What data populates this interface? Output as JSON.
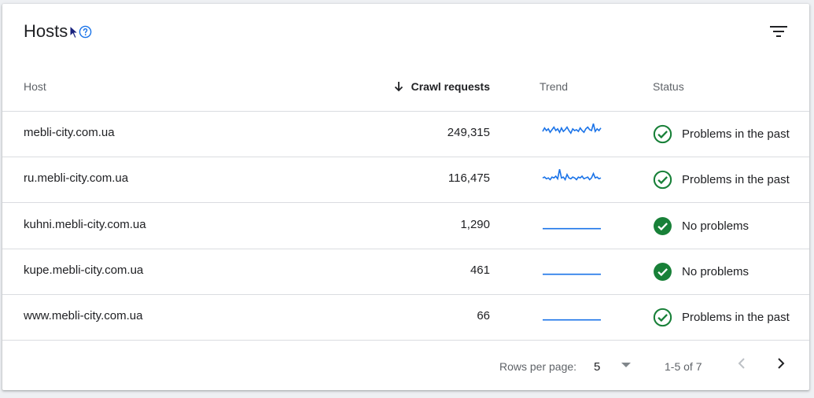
{
  "header": {
    "title": "Hosts",
    "help_icon": "help-circle-icon",
    "filter_icon": "filter-icon"
  },
  "table": {
    "columns": {
      "host": "Host",
      "crawl_requests": "Crawl requests",
      "trend": "Trend",
      "status": "Status"
    },
    "sort": {
      "column": "crawl_requests",
      "direction": "descending",
      "icon": "arrow-down-icon"
    },
    "rows": [
      {
        "host": "mebli-city.com.ua",
        "crawl_requests": "249,315",
        "status": "Problems in the past",
        "status_icon": "check-circle-outline-icon",
        "trend": [
          0.55,
          0.35,
          0.5,
          0.4,
          0.6,
          0.45,
          0.3,
          0.5,
          0.4,
          0.6,
          0.35,
          0.55,
          0.45,
          0.3,
          0.5,
          0.65,
          0.4,
          0.5,
          0.45,
          0.55,
          0.35,
          0.5,
          0.6,
          0.4,
          0.3,
          0.45,
          0.5,
          0.1,
          0.55,
          0.4,
          0.5,
          0.35
        ]
      },
      {
        "host": "ru.mebli-city.com.ua",
        "crawl_requests": "116,475",
        "status": "Problems in the past",
        "status_icon": "check-circle-outline-icon",
        "trend": [
          0.6,
          0.55,
          0.65,
          0.6,
          0.7,
          0.55,
          0.6,
          0.5,
          0.65,
          0.1,
          0.6,
          0.55,
          0.7,
          0.4,
          0.6,
          0.65,
          0.55,
          0.6,
          0.7,
          0.55,
          0.6,
          0.5,
          0.65,
          0.6,
          0.55,
          0.7,
          0.6,
          0.35,
          0.6,
          0.55,
          0.65,
          0.6
        ]
      },
      {
        "host": "kuhni.mebli-city.com.ua",
        "crawl_requests": "1,290",
        "status": "No problems",
        "status_icon": "check-circle-filled-icon",
        "trend": [
          0.85,
          0.85,
          0.85,
          0.85,
          0.85,
          0.85,
          0.85,
          0.85
        ]
      },
      {
        "host": "kupe.mebli-city.com.ua",
        "crawl_requests": "461",
        "status": "No problems",
        "status_icon": "check-circle-filled-icon",
        "trend": [
          0.85,
          0.85,
          0.85,
          0.85,
          0.85,
          0.85,
          0.85,
          0.85
        ]
      },
      {
        "host": "www.mebli-city.com.ua",
        "crawl_requests": "66",
        "status": "Problems in the past",
        "status_icon": "check-circle-outline-icon",
        "trend": [
          0.85,
          0.85,
          0.85,
          0.85,
          0.85,
          0.85,
          0.85,
          0.85
        ]
      }
    ]
  },
  "pagination": {
    "rows_per_page_label": "Rows per page:",
    "rows_per_page_value": "5",
    "range": "1-5 of 7",
    "prev_icon": "chevron-left-icon",
    "next_icon": "chevron-right-icon"
  },
  "colors": {
    "trend_line": "#1a73e8",
    "status_green": "#188038",
    "link_blue": "#1a73e8",
    "disabled": "#bdc1c6"
  }
}
